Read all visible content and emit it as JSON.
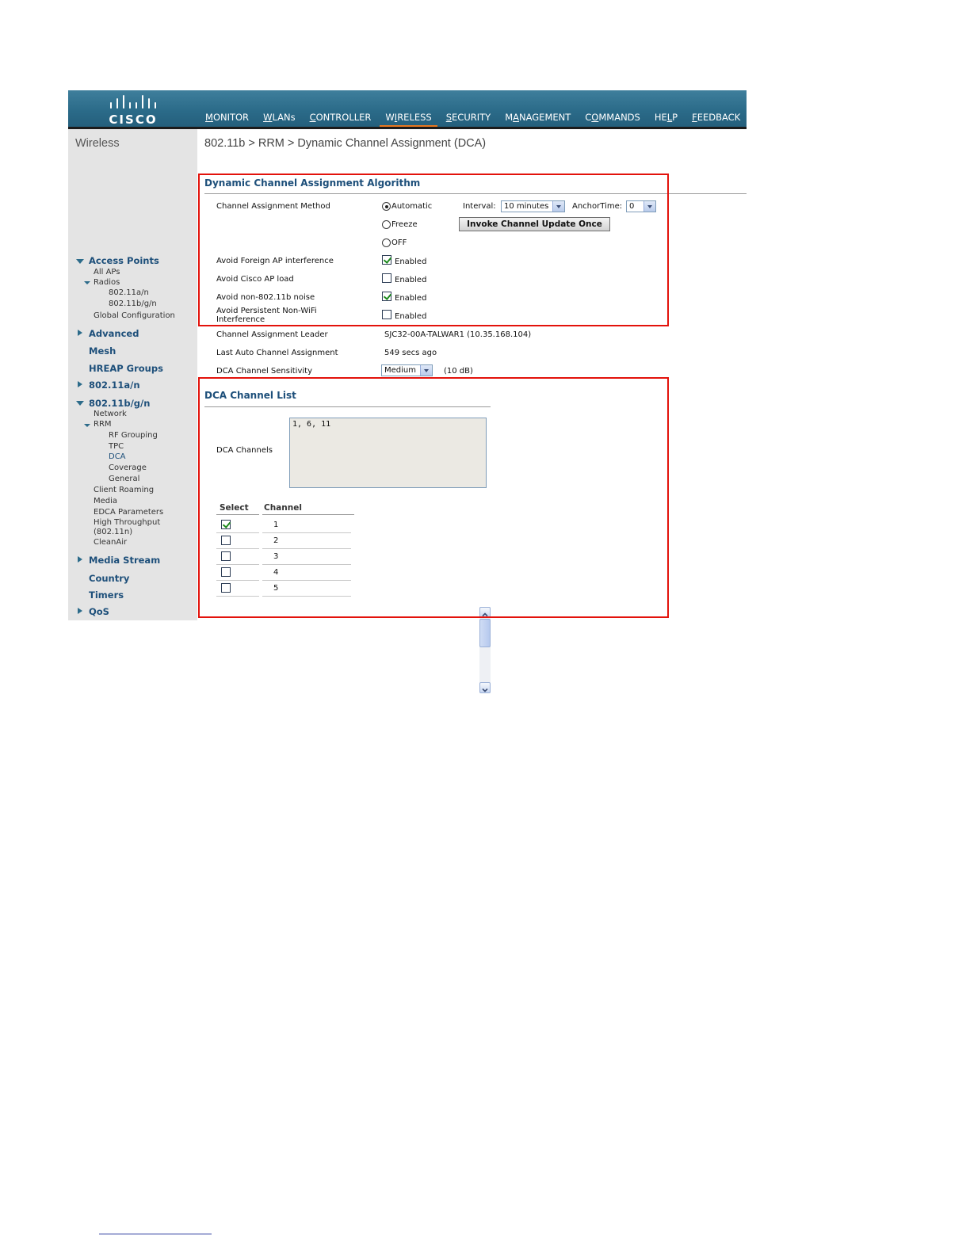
{
  "header": {
    "logo_text": "CISCO",
    "nav": [
      {
        "u": "M",
        "rest": "ONITOR",
        "pre": ""
      },
      {
        "u": "W",
        "rest": "LANs",
        "pre": ""
      },
      {
        "u": "C",
        "rest": "ONTROLLER",
        "pre": ""
      },
      {
        "pre": "W",
        "u": "I",
        "rest": "RELESS"
      },
      {
        "u": "S",
        "rest": "ECURITY",
        "pre": ""
      },
      {
        "pre": "M",
        "u": "A",
        "rest": "NAGEMENT"
      },
      {
        "pre": "C",
        "u": "O",
        "rest": "MMANDS"
      },
      {
        "pre": "HE",
        "u": "L",
        "rest": "P"
      },
      {
        "u": "F",
        "rest": "EEDBACK",
        "pre": ""
      }
    ],
    "active_index": 3,
    "accent": "#e8771f"
  },
  "sidebar": {
    "title": "Wireless",
    "access_points": "Access Points",
    "all_aps": "All APs",
    "radios": "Radios",
    "radio_a": "802.11a/n",
    "radio_bg": "802.11b/g/n",
    "global_config": "Global Configuration",
    "advanced": "Advanced",
    "mesh": "Mesh",
    "hreap": "HREAP Groups",
    "b80211an": "802.11a/n",
    "b80211bgn": "802.11b/g/n",
    "network": "Network",
    "rrm": "RRM",
    "rf_grouping": "RF Grouping",
    "tpc": "TPC",
    "dca": "DCA",
    "coverage": "Coverage",
    "general": "General",
    "client_roaming": "Client Roaming",
    "media": "Media",
    "edca": "EDCA Parameters",
    "ht1": "High Throughput",
    "ht2": "(802.11n)",
    "cleanair": "CleanAir",
    "media_stream": "Media Stream",
    "country": "Country",
    "timers": "Timers",
    "qos": "QoS"
  },
  "main": {
    "page_title": "802.11b > RRM > Dynamic Channel Assignment (DCA)",
    "algo_title": "Dynamic Channel Assignment Algorithm",
    "method_label": "Channel Assignment Method",
    "opt_automatic": "Automatic",
    "opt_freeze": "Freeze",
    "opt_off": "OFF",
    "interval_label": "Interval:",
    "interval_value": "10 minutes",
    "anchor_label": "AnchorTime:",
    "anchor_value": "0",
    "invoke_button": "Invoke Channel Update Once",
    "foreign_label": "Avoid Foreign AP interference",
    "cisco_load_label": "Avoid Cisco AP load",
    "non80211_label": "Avoid non-802.11b noise",
    "persistent_label": "Avoid Persistent Non-WiFi Interference",
    "enabled": "Enabled",
    "leader_label": "Channel Assignment Leader",
    "leader_value": "SJC32-00A-TALWAR1 (10.35.168.104)",
    "last_auto_label": "Last Auto Channel Assignment",
    "last_auto_value": "549 secs ago",
    "sensitivity_label": "DCA Channel Sensitivity",
    "sensitivity_value": "Medium",
    "sensitivity_db": "(10 dB)",
    "list_title": "DCA Channel List",
    "channels_label": "DCA Channels",
    "channels_value": "1, 6, 11",
    "col_select": "Select",
    "col_channel": "Channel",
    "rows": [
      {
        "channel": "1",
        "checked": true
      },
      {
        "channel": "2",
        "checked": false
      },
      {
        "channel": "3",
        "checked": false
      },
      {
        "channel": "4",
        "checked": false
      },
      {
        "channel": "5",
        "checked": false
      }
    ]
  }
}
